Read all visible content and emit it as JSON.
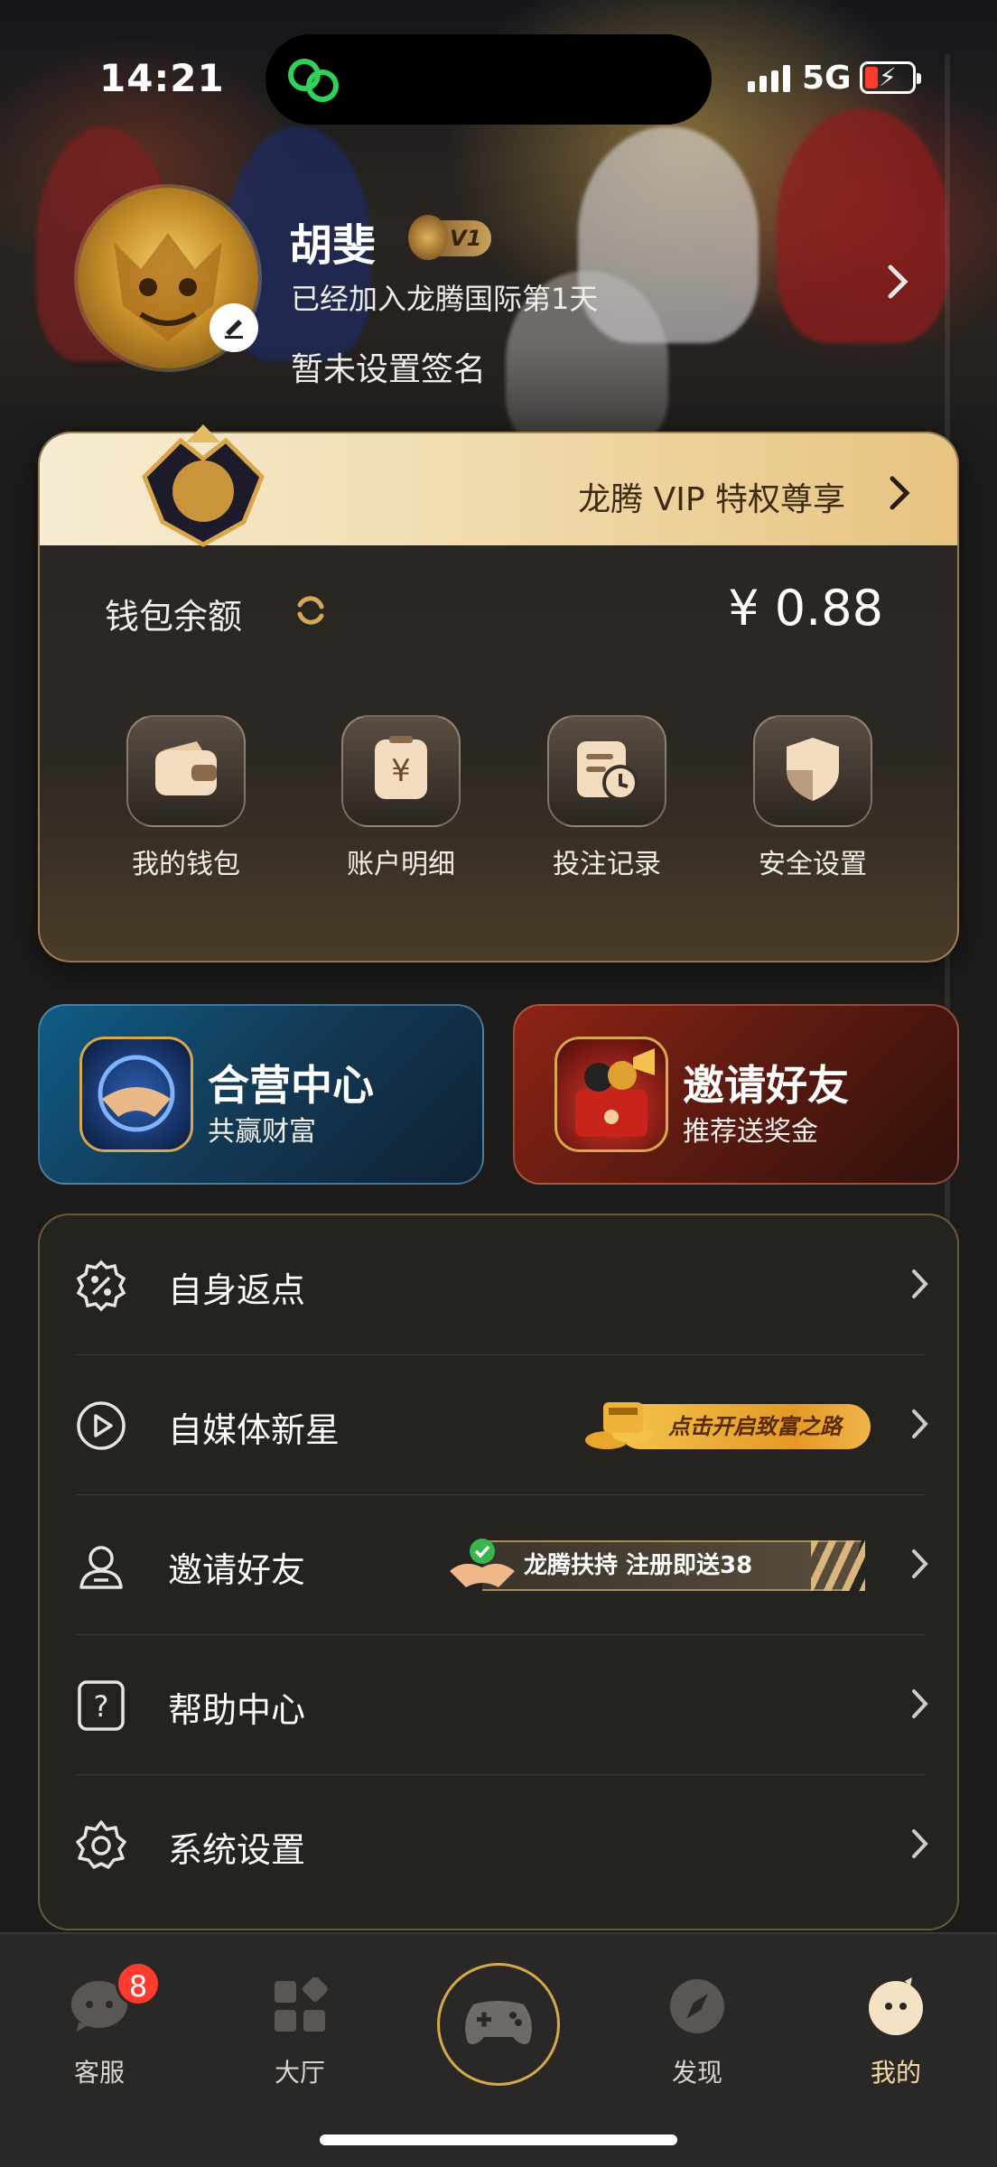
{
  "status_bar": {
    "time": "14:21",
    "network": "5G"
  },
  "profile": {
    "name": "胡斐",
    "vip_level": "V1",
    "joined_text": "已经加入龙腾国际第1天",
    "signature": "暂未设置签名"
  },
  "vip_banner": {
    "label": "龙腾 VIP 特权尊享"
  },
  "wallet": {
    "label": "钱包余额",
    "amount": "¥ 0.88",
    "actions": [
      {
        "label": "我的钱包",
        "icon": "wallet-icon"
      },
      {
        "label": "账户明细",
        "icon": "receipt-yen-icon"
      },
      {
        "label": "投注记录",
        "icon": "bet-record-icon"
      },
      {
        "label": "安全设置",
        "icon": "shield-icon"
      }
    ]
  },
  "promos": {
    "agent": {
      "title": "合营中心",
      "subtitle": "共赢财富"
    },
    "invite": {
      "title": "邀请好友",
      "subtitle": "推荐送奖金"
    }
  },
  "menu": {
    "items": [
      {
        "label": "自身返点",
        "icon": "percent-badge-icon"
      },
      {
        "label": "自媒体新星",
        "icon": "play-circle-icon",
        "tag": "点击开启致富之路"
      },
      {
        "label": "邀请好友",
        "icon": "user-invite-icon",
        "tag": "龙腾扶持 注册即送38"
      },
      {
        "label": "帮助中心",
        "icon": "help-icon"
      },
      {
        "label": "系统设置",
        "icon": "gear-icon"
      }
    ]
  },
  "tabbar": {
    "items": [
      {
        "label": "客服",
        "icon": "chat-bubble-icon",
        "badge": "8"
      },
      {
        "label": "大厅",
        "icon": "grid-icon"
      },
      {
        "label": "",
        "icon": "gamepad-icon"
      },
      {
        "label": "发现",
        "icon": "compass-icon"
      },
      {
        "label": "我的",
        "icon": "profile-face-icon",
        "active": true
      }
    ]
  },
  "colors": {
    "accent_gold": "#d4a94a",
    "badge_red": "#ff3b30",
    "background": "#1c1b1a"
  }
}
